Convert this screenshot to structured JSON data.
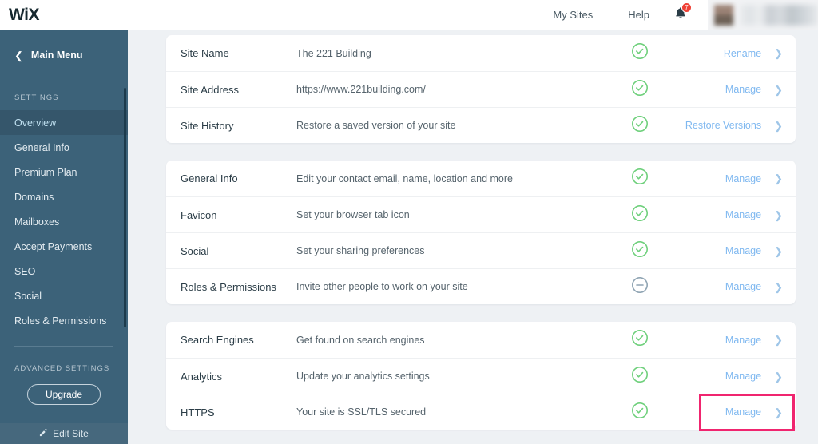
{
  "topbar": {
    "logo": "WiX",
    "links": [
      {
        "label": "My Sites",
        "name": "my-sites-link"
      },
      {
        "label": "Help",
        "name": "help-link"
      }
    ],
    "notifications": {
      "icon": "bell-icon",
      "badge_count": "7"
    },
    "account": {
      "redacted": true
    }
  },
  "sidebar": {
    "back_label": "Main Menu",
    "settings_label": "SETTINGS",
    "items": [
      {
        "label": "Overview",
        "active": true
      },
      {
        "label": "General Info",
        "active": false
      },
      {
        "label": "Premium Plan",
        "active": false
      },
      {
        "label": "Domains",
        "active": false
      },
      {
        "label": "Mailboxes",
        "active": false
      },
      {
        "label": "Accept Payments",
        "active": false
      },
      {
        "label": "SEO",
        "active": false
      },
      {
        "label": "Social",
        "active": false
      },
      {
        "label": "Roles & Permissions",
        "active": false
      }
    ],
    "advanced_label": "ADVANCED SETTINGS",
    "upgrade_label": "Upgrade",
    "edit_site_label": "Edit Site"
  },
  "colors": {
    "sidebar_bg": "#3c6279",
    "accent_link": "#7fb8f0",
    "status_ok": "#6fd07c",
    "status_neutral": "#8fa4b3",
    "highlight": "#f0256f",
    "page_bg": "#eef1f4"
  },
  "cards": [
    {
      "name": "site-basics-card",
      "rows": [
        {
          "title": "Site Name",
          "desc": "The 221 Building",
          "status": "ok",
          "action": "Rename"
        },
        {
          "title": "Site Address",
          "desc": "https://www.221building.com/",
          "status": "ok",
          "action": "Manage"
        },
        {
          "title": "Site History",
          "desc": "Restore a saved version of your site",
          "status": "ok",
          "action": "Restore Versions"
        }
      ]
    },
    {
      "name": "site-info-card",
      "rows": [
        {
          "title": "General Info",
          "desc": "Edit your contact email, name, location and more",
          "status": "ok",
          "action": "Manage"
        },
        {
          "title": "Favicon",
          "desc": "Set your browser tab icon",
          "status": "ok",
          "action": "Manage"
        },
        {
          "title": "Social",
          "desc": "Set your sharing preferences",
          "status": "ok",
          "action": "Manage"
        },
        {
          "title": "Roles & Permissions",
          "desc": "Invite other people to work on your site",
          "status": "neutral",
          "action": "Manage"
        }
      ]
    },
    {
      "name": "marketing-card",
      "rows": [
        {
          "title": "Search Engines",
          "desc": "Get found on search engines",
          "status": "ok",
          "action": "Manage"
        },
        {
          "title": "Analytics",
          "desc": "Update your analytics settings",
          "status": "ok",
          "action": "Manage"
        },
        {
          "title": "HTTPS",
          "desc": "Your site is SSL/TLS secured",
          "status": "ok",
          "action": "Manage",
          "highlighted": true
        }
      ]
    }
  ]
}
